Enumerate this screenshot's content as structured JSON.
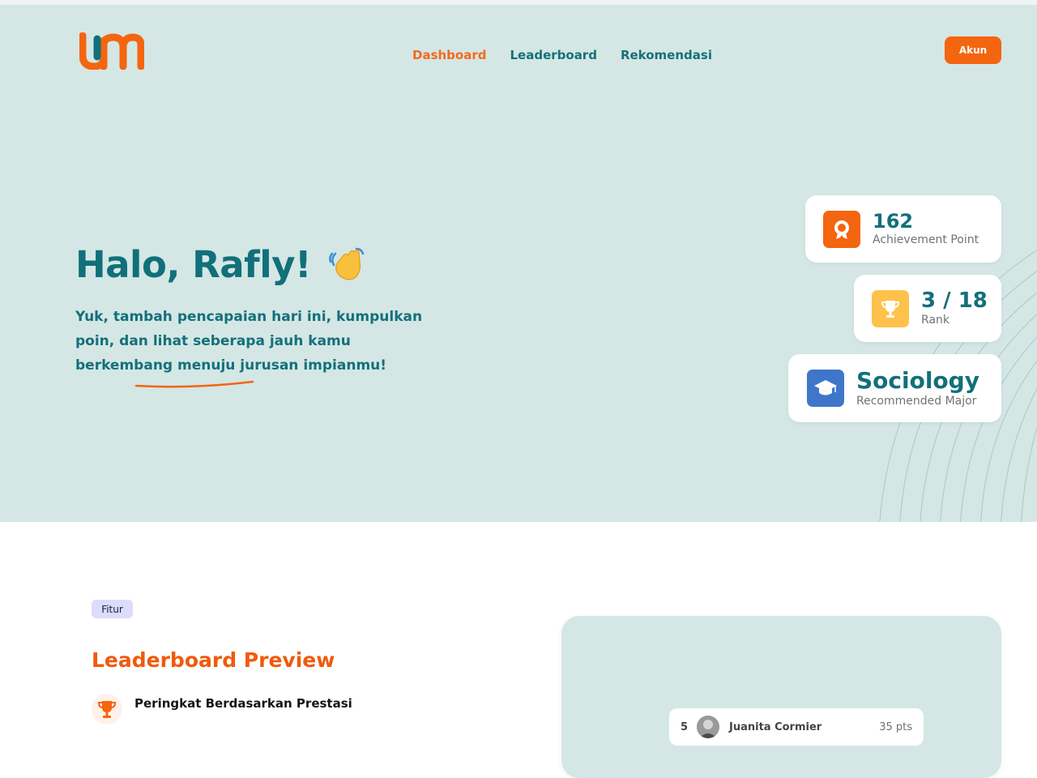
{
  "nav": {
    "items": [
      {
        "label": "Dashboard",
        "active": true
      },
      {
        "label": "Leaderboard",
        "active": false
      },
      {
        "label": "Rekomendasi",
        "active": false
      }
    ],
    "account_label": "Akun"
  },
  "hero": {
    "greeting": "Halo, Rafly!",
    "subtitle": "Yuk, tambah pencapaian hari ini, kumpulkan poin, dan lihat seberapa jauh kamu berkembang menuju jurusan impianmu!"
  },
  "stats": {
    "points": {
      "value": "162",
      "label": "Achievement Point",
      "icon": "award-icon"
    },
    "rank": {
      "value": "3 / 18",
      "label": "Rank",
      "icon": "trophy-icon"
    },
    "major": {
      "value": "Sociology",
      "label": "Recommended Major",
      "icon": "graduation-cap-icon"
    }
  },
  "feature": {
    "badge": "Fitur",
    "title": "Leaderboard Preview",
    "item": "Peringkat Berdasarkan Prestasi"
  },
  "leaderboard_preview": {
    "rows": [
      {
        "rank": "5",
        "name": "Juanita Cormier",
        "points": "35 pts"
      }
    ]
  },
  "colors": {
    "brand_orange": "#f4650f",
    "brand_teal": "#11707a",
    "hero_bg": "#d4e7e5"
  }
}
